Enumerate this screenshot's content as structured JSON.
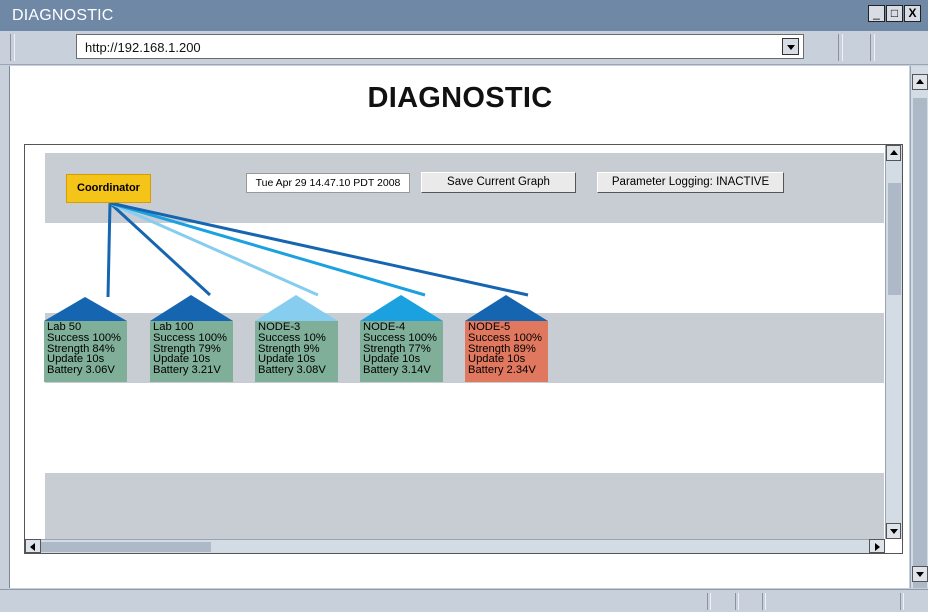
{
  "window": {
    "title": "DIAGNOSTIC",
    "controls": {
      "minimize": "_",
      "restore": "□",
      "close": "X"
    }
  },
  "address_bar": {
    "url": "http://192.168.1.200"
  },
  "page": {
    "heading": "DIAGNOSTIC"
  },
  "applet": {
    "coordinator_label": "Coordinator",
    "timestamp": "Tue Apr 29 14.47.10 PDT 2008",
    "save_button_label": "Save Current Graph",
    "logging_button_label": "Parameter Logging: INACTIVE",
    "nodes": [
      {
        "name": "Lab 50",
        "success": "Success 100%",
        "strength": "Strength 84%",
        "update": "Update 10s",
        "battery": "Battery 3.06V",
        "status_color": "#7fae99",
        "link_color": "#1565b0"
      },
      {
        "name": "Lab 100",
        "success": "Success 100%",
        "strength": "Strength 79%",
        "update": "Update 10s",
        "battery": "Battery 3.21V",
        "status_color": "#7fae99",
        "link_color": "#1565b0"
      },
      {
        "name": "NODE-3",
        "success": "Success 10%",
        "strength": "Strength 9%",
        "update": "Update 10s",
        "battery": "Battery 3.08V",
        "status_color": "#7fae99",
        "link_color": "#87cdef"
      },
      {
        "name": "NODE-4",
        "success": "Success 100%",
        "strength": "Strength 77%",
        "update": "Update 10s",
        "battery": "Battery 3.14V",
        "status_color": "#7fae99",
        "link_color": "#1ba1df"
      },
      {
        "name": "NODE-5",
        "success": "Success 100%",
        "strength": "Strength 89%",
        "update": "Update 10s",
        "battery": "Battery 2.34V",
        "status_color": "#e0785f",
        "link_color": "#1565b0"
      }
    ]
  },
  "colors": {
    "titlebar": "#6f88a6",
    "coordinator": "#f5c419",
    "band": "#c8cdd4",
    "node_ok": "#7fae99",
    "node_alert": "#e0785f"
  }
}
